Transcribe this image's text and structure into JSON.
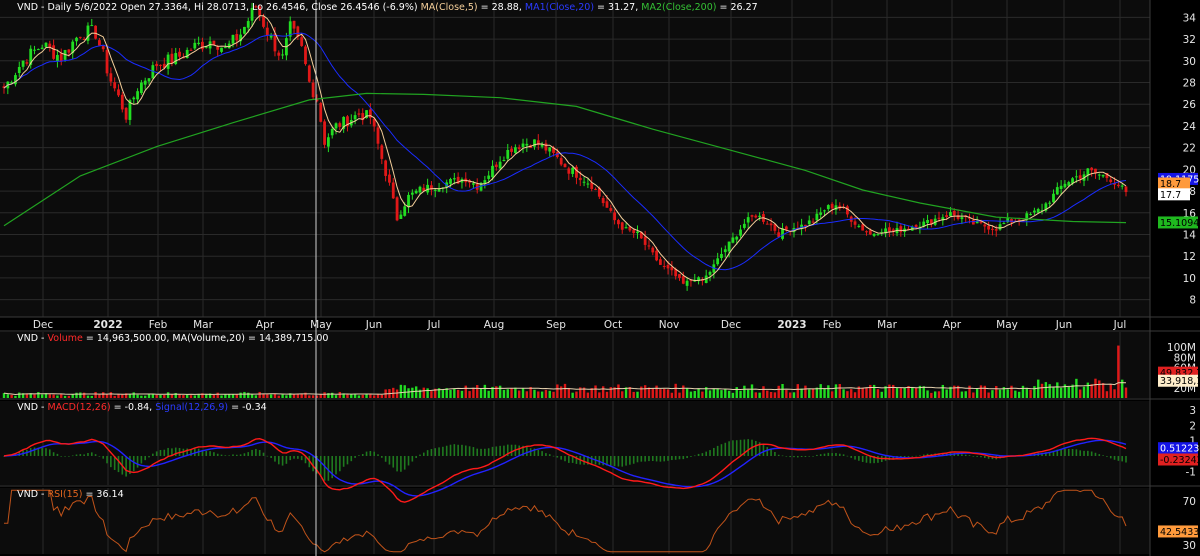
{
  "chart_data": [
    {
      "type": "candlestick",
      "panel": "price",
      "header": {
        "symbol": "VND",
        "info": " - Daily 5/6/2022 Open 27.3364, Hi 28.0713, Lo 26.4546, Close 26.4546 (-6.9%) ",
        "ma5_label": "MA(Close,5)",
        "ma5_value": " = 28.88, ",
        "ma20_label": "MA1(Close,20)",
        "ma20_value": " = 31.27, ",
        "ma200_label": "MA2(Close,200)",
        "ma200_value": " = 26.27"
      },
      "x_labels": [
        "Dec",
        "2022",
        "Feb",
        "Mar",
        "Apr",
        "May",
        "Jun",
        "Jul",
        "Aug",
        "Sep",
        "Oct",
        "Nov",
        "Dec",
        "2023",
        "Feb",
        "Mar",
        "Apr",
        "May",
        "Jun",
        "Jul"
      ],
      "bold_x_labels": [
        "2022",
        "2023"
      ],
      "y_ticks": [
        8,
        10,
        12,
        14,
        16,
        18,
        20,
        22,
        24,
        26,
        28,
        30,
        32,
        34
      ],
      "ylim": [
        6.4,
        35.6
      ],
      "price_path": [
        {
          "x": 0,
          "y": 27.5
        },
        {
          "x": 5,
          "y": 30.0
        },
        {
          "x": 10,
          "y": 31.5
        },
        {
          "x": 15,
          "y": 30.3
        },
        {
          "x": 20,
          "y": 32.6
        },
        {
          "x": 24,
          "y": 32.6
        },
        {
          "x": 28,
          "y": 28.2
        },
        {
          "x": 32,
          "y": 25.0
        },
        {
          "x": 35,
          "y": 27.5
        },
        {
          "x": 40,
          "y": 29.7
        },
        {
          "x": 45,
          "y": 30.2
        },
        {
          "x": 50,
          "y": 31.3
        },
        {
          "x": 55,
          "y": 32.0
        },
        {
          "x": 58,
          "y": 31.0
        },
        {
          "x": 62,
          "y": 32.5
        },
        {
          "x": 66,
          "y": 35.0
        },
        {
          "x": 70,
          "y": 32.0
        },
        {
          "x": 73,
          "y": 30.2
        },
        {
          "x": 75,
          "y": 33.0
        },
        {
          "x": 78,
          "y": 31.0
        },
        {
          "x": 80,
          "y": 28.0
        },
        {
          "x": 82,
          "y": 26.5
        },
        {
          "x": 84,
          "y": 22.6
        },
        {
          "x": 87,
          "y": 24.0
        },
        {
          "x": 90,
          "y": 24.5
        },
        {
          "x": 93,
          "y": 25.1
        },
        {
          "x": 96,
          "y": 24.8
        },
        {
          "x": 99,
          "y": 21.0
        },
        {
          "x": 101,
          "y": 18.5
        },
        {
          "x": 103,
          "y": 15.5
        },
        {
          "x": 106,
          "y": 17.5
        },
        {
          "x": 109,
          "y": 18.1
        },
        {
          "x": 112,
          "y": 18.4
        },
        {
          "x": 115,
          "y": 18.7
        },
        {
          "x": 118,
          "y": 18.9
        },
        {
          "x": 121,
          "y": 19.2
        },
        {
          "x": 124,
          "y": 18.5
        },
        {
          "x": 127,
          "y": 19.6
        },
        {
          "x": 130,
          "y": 21.0
        },
        {
          "x": 133,
          "y": 22.0
        },
        {
          "x": 136,
          "y": 22.4
        },
        {
          "x": 139,
          "y": 22.5
        },
        {
          "x": 142,
          "y": 21.9
        },
        {
          "x": 145,
          "y": 21.0
        },
        {
          "x": 148,
          "y": 20.0
        },
        {
          "x": 151,
          "y": 19.4
        },
        {
          "x": 154,
          "y": 18.6
        },
        {
          "x": 157,
          "y": 17.0
        },
        {
          "x": 160,
          "y": 15.3
        },
        {
          "x": 163,
          "y": 14.4
        },
        {
          "x": 166,
          "y": 14.0
        },
        {
          "x": 169,
          "y": 12.6
        },
        {
          "x": 172,
          "y": 11.2
        },
        {
          "x": 175,
          "y": 10.5
        },
        {
          "x": 178,
          "y": 9.4
        },
        {
          "x": 181,
          "y": 10.0
        },
        {
          "x": 183,
          "y": 9.7
        },
        {
          "x": 185,
          "y": 10.6
        },
        {
          "x": 188,
          "y": 12.2
        },
        {
          "x": 191,
          "y": 13.6
        },
        {
          "x": 194,
          "y": 15.0
        },
        {
          "x": 197,
          "y": 15.8
        },
        {
          "x": 200,
          "y": 15.2
        },
        {
          "x": 203,
          "y": 14.1
        },
        {
          "x": 206,
          "y": 14.6
        },
        {
          "x": 209,
          "y": 14.8
        },
        {
          "x": 212,
          "y": 15.3
        },
        {
          "x": 215,
          "y": 16.3
        },
        {
          "x": 218,
          "y": 16.8
        },
        {
          "x": 221,
          "y": 15.8
        },
        {
          "x": 224,
          "y": 14.8
        },
        {
          "x": 227,
          "y": 14.0
        },
        {
          "x": 230,
          "y": 14.5
        },
        {
          "x": 233,
          "y": 14.2
        },
        {
          "x": 236,
          "y": 14.6
        },
        {
          "x": 239,
          "y": 14.9
        },
        {
          "x": 242,
          "y": 15.1
        },
        {
          "x": 245,
          "y": 15.6
        },
        {
          "x": 248,
          "y": 15.9
        },
        {
          "x": 251,
          "y": 15.5
        },
        {
          "x": 254,
          "y": 15.0
        },
        {
          "x": 257,
          "y": 14.8
        },
        {
          "x": 260,
          "y": 14.6
        },
        {
          "x": 263,
          "y": 15.2
        },
        {
          "x": 266,
          "y": 15.4
        },
        {
          "x": 269,
          "y": 15.8
        },
        {
          "x": 272,
          "y": 16.4
        },
        {
          "x": 275,
          "y": 17.6
        },
        {
          "x": 278,
          "y": 18.8
        },
        {
          "x": 281,
          "y": 19.3
        },
        {
          "x": 284,
          "y": 19.8
        },
        {
          "x": 287,
          "y": 19.5
        },
        {
          "x": 290,
          "y": 19.2
        },
        {
          "x": 292,
          "y": 18.6
        },
        {
          "x": 294,
          "y": 17.7
        }
      ],
      "ma200_path": [
        {
          "x": 0,
          "y": 14.8
        },
        {
          "x": 20,
          "y": 19.4
        },
        {
          "x": 40,
          "y": 22.1
        },
        {
          "x": 60,
          "y": 24.3
        },
        {
          "x": 80,
          "y": 26.4
        },
        {
          "x": 95,
          "y": 27.0
        },
        {
          "x": 110,
          "y": 26.9
        },
        {
          "x": 130,
          "y": 26.6
        },
        {
          "x": 150,
          "y": 25.8
        },
        {
          "x": 170,
          "y": 23.7
        },
        {
          "x": 190,
          "y": 21.8
        },
        {
          "x": 210,
          "y": 19.9
        },
        {
          "x": 225,
          "y": 18.1
        },
        {
          "x": 240,
          "y": 16.9
        },
        {
          "x": 260,
          "y": 15.6
        },
        {
          "x": 280,
          "y": 15.2
        },
        {
          "x": 294,
          "y": 15.1
        }
      ],
      "last_values": [
        {
          "text": "19.1175",
          "bg": "#1414e6",
          "fg": "#ffffff",
          "y": 19.1175
        },
        {
          "text": "18.7",
          "bg": "#ff9a3c",
          "fg": "#000000",
          "y": 18.7
        },
        {
          "text": "17.7",
          "bg": "#ffffff",
          "fg": "#000000",
          "y": 17.7
        },
        {
          "text": "15.1094",
          "bg": "#1fb81f",
          "fg": "#000000",
          "y": 15.1094
        }
      ],
      "cursor_date": "5/6/2022"
    },
    {
      "type": "bar",
      "panel": "volume",
      "header": {
        "symbol": "VND",
        "sep": " - ",
        "vol_label": "Volume",
        "vol_value": " = 14,963,500.00, ",
        "ma_label": "MA(Volume,20)",
        "ma_value": " = 14,389,715.00"
      },
      "y_ticks": [
        "100M",
        "80M",
        "60M",
        "20M"
      ],
      "ylim": [
        0,
        110
      ],
      "last_values": [
        {
          "text": "49,832,7",
          "bg": "#e02020",
          "fg": "#000000",
          "y": 49.8
        },
        {
          "text": "33,918,1",
          "bg": "#ffeecb",
          "fg": "#000000",
          "y": 33.9
        }
      ]
    },
    {
      "type": "line",
      "panel": "macd",
      "header": {
        "symbol": "VND",
        "sep": " - ",
        "macd_label": "MACD(12,26)",
        "macd_value": " = -0.84, ",
        "signal_label": "Signal(12,26,9)",
        "signal_value": " = -0.34"
      },
      "y_ticks": [
        3,
        2,
        1,
        0,
        -1
      ],
      "ylim": [
        -1.9,
        3.6
      ],
      "last_values": [
        {
          "text": "0.512236",
          "bg": "#1414e6",
          "fg": "#ffffff",
          "y": 0.51
        },
        {
          "text": "-0.23242",
          "bg": "#e02020",
          "fg": "#000000",
          "y": -0.23
        }
      ]
    },
    {
      "type": "line",
      "panel": "rsi",
      "header": {
        "symbol": "VND",
        "sep": " - ",
        "rsi_label": "RSI(15)",
        "rsi_value": " = 36.14"
      },
      "y_ticks": [
        70,
        30
      ],
      "ylim": [
        22,
        82
      ],
      "last_values": [
        {
          "text": "42.5433",
          "bg": "#ff9a3c",
          "fg": "#000000",
          "y": 42.5
        }
      ]
    }
  ],
  "colors": {
    "up": "#22dd22",
    "down": "#e01818",
    "ma5": "#f5cf9a",
    "ma20": "#1a2cff",
    "ma200": "#21a321",
    "macd": "#ff1a1a",
    "signal": "#2222ff",
    "rsi": "#c0531a",
    "vol_ma": "#e6d3b0",
    "bg": "#000000",
    "panel_bg": "#0a0a0a",
    "grid": "#2a2a2a",
    "cursor": "#cfcfcf"
  }
}
